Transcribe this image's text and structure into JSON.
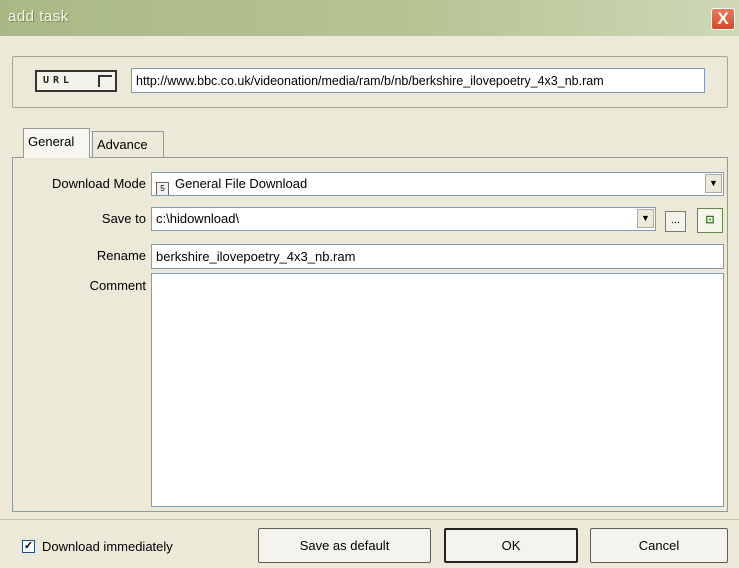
{
  "window": {
    "title": "add task",
    "close_label": "X"
  },
  "url": {
    "icon_label": "URL",
    "value": "http://www.bbc.co.uk/videonation/media/ram/b/nb/berkshire_ilovepoetry_4x3_nb.ram"
  },
  "tabs": {
    "general": "General",
    "advance": "Advance"
  },
  "form": {
    "download_mode_label": "Download Mode",
    "download_mode_value": "General File Download",
    "save_to_label": "Save to",
    "save_to_value": "c:\\hidownload\\",
    "browse_label": "...",
    "rename_label": "Rename",
    "rename_value": "berkshire_ilovepoetry_4x3_nb.ram",
    "comment_label": "Comment",
    "comment_value": ""
  },
  "footer": {
    "download_immediately_label": "Download immediately",
    "download_immediately_checked": true,
    "save_default_label": "Save as default",
    "ok_label": "OK",
    "cancel_label": "Cancel"
  },
  "icons": {
    "url": "url-icon",
    "close": "close-icon",
    "download_mode": "download-mode-icon",
    "combo_arrow": "chevron-down-icon",
    "folder": "folder-icon",
    "check": "check-icon"
  }
}
